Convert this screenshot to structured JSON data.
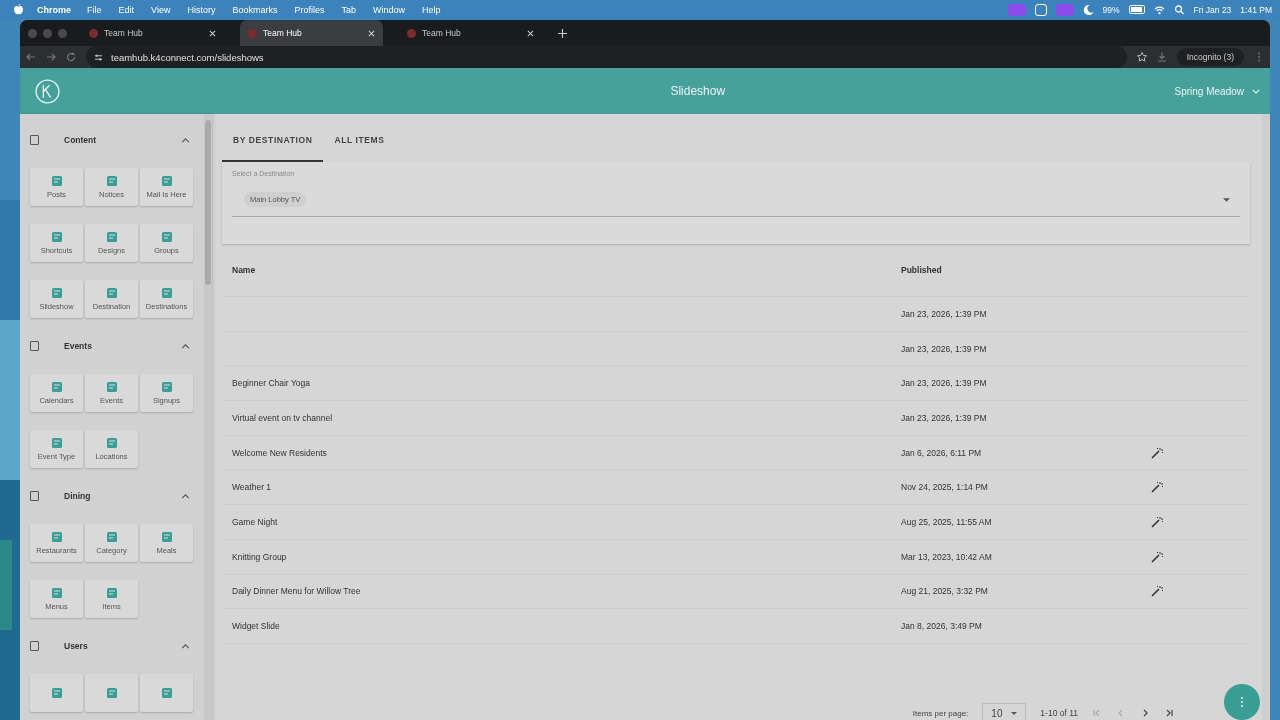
{
  "menu_bar": {
    "app": "Chrome",
    "items": [
      "File",
      "Edit",
      "View",
      "History",
      "Bookmarks",
      "Profiles",
      "Tab",
      "Window",
      "Help"
    ],
    "battery": "99%",
    "date": "Fri Jan 23",
    "time": "1:41 PM"
  },
  "browser": {
    "tabs": [
      {
        "title": "Team Hub",
        "selected": false
      },
      {
        "title": "Team Hub",
        "selected": true
      },
      {
        "title": "Team Hub",
        "selected": false
      }
    ],
    "url": "teamhub.k4connect.com/slideshows",
    "profile": "Incognito (3)"
  },
  "header": {
    "title": "Slideshow",
    "community": "Spring Meadow"
  },
  "sidebar": {
    "sections": [
      {
        "title": "Content",
        "expanded": true,
        "items": [
          {
            "kind": "labeled",
            "label": "Posts"
          },
          {
            "kind": "labeled",
            "label": "Notices"
          },
          {
            "kind": "labeled",
            "label": "Mail Is Here"
          },
          {
            "kind": "labeled",
            "label": "Shortcuts"
          },
          {
            "kind": "labeled",
            "label": "Designs"
          },
          {
            "kind": "labeled",
            "label": "Groups"
          },
          {
            "kind": "labeled",
            "label": "Slideshow"
          },
          {
            "kind": "labeled",
            "label": "Destination"
          },
          {
            "kind": "labeled",
            "label": "Destinations"
          }
        ]
      },
      {
        "title": "Events",
        "expanded": true,
        "items": [
          {
            "kind": "labeled",
            "label": "Calendars"
          },
          {
            "kind": "labeled",
            "label": "Events"
          },
          {
            "kind": "labeled",
            "label": "Signups"
          },
          {
            "kind": "labeled",
            "label": "Event Type"
          },
          {
            "kind": "labeled",
            "label": "Locations"
          }
        ]
      },
      {
        "title": "Dining",
        "expanded": true,
        "items": [
          {
            "kind": "labeled",
            "label": "Restaurants"
          },
          {
            "kind": "labeled",
            "label": "Category"
          },
          {
            "kind": "labeled",
            "label": "Meals"
          },
          {
            "kind": "labeled",
            "label": "Menus"
          },
          {
            "kind": "labeled",
            "label": "Items"
          }
        ]
      },
      {
        "title": "Users",
        "expanded": true,
        "items": [
          {
            "kind": "icon-only"
          },
          {
            "kind": "icon-only"
          },
          {
            "kind": "icon-only"
          }
        ]
      }
    ]
  },
  "tabs": [
    {
      "label": "BY DESTINATION",
      "selected": true
    },
    {
      "label": "ALL ITEMS",
      "selected": false
    }
  ],
  "destination_select": {
    "label": "Select a Destination",
    "chip": "Main Lobby TV"
  },
  "table": {
    "columns": [
      "Name",
      "Published"
    ],
    "rows": [
      {
        "published": "Jan 23, 2026, 1:39 PM",
        "action": false
      },
      {
        "published": "Jan 23, 2026, 1:39 PM",
        "action": false
      },
      {
        "name": "Beginner Chair Yoga",
        "published": "Jan 23, 2026, 1:39 PM",
        "action": false
      },
      {
        "name": "Virtual event on tv channel",
        "published": "Jan 23, 2026, 1:39 PM",
        "action": false
      },
      {
        "name": "Welcome New Residents",
        "published": "Jan 6, 2026, 6:11 PM",
        "action": true
      },
      {
        "name": "Weather 1",
        "published": "Nov 24, 2025, 1:14 PM",
        "action": true
      },
      {
        "name": "Game Night",
        "published": "Aug 25, 2025, 11:55 AM",
        "action": true
      },
      {
        "name": "Knitting Group",
        "published": "Mar 13, 2023, 10:42 AM",
        "action": true
      },
      {
        "name": "Daily Dinner Menu for Willow Tree",
        "published": "Aug 21, 2025, 3:32 PM",
        "action": true
      },
      {
        "name": "Widget Slide",
        "published": "Jan 8, 2026, 3:49 PM",
        "action": false
      }
    ]
  },
  "pagination": {
    "label": "Items per page:",
    "per_page": "10",
    "range": "1-10 of 11"
  }
}
